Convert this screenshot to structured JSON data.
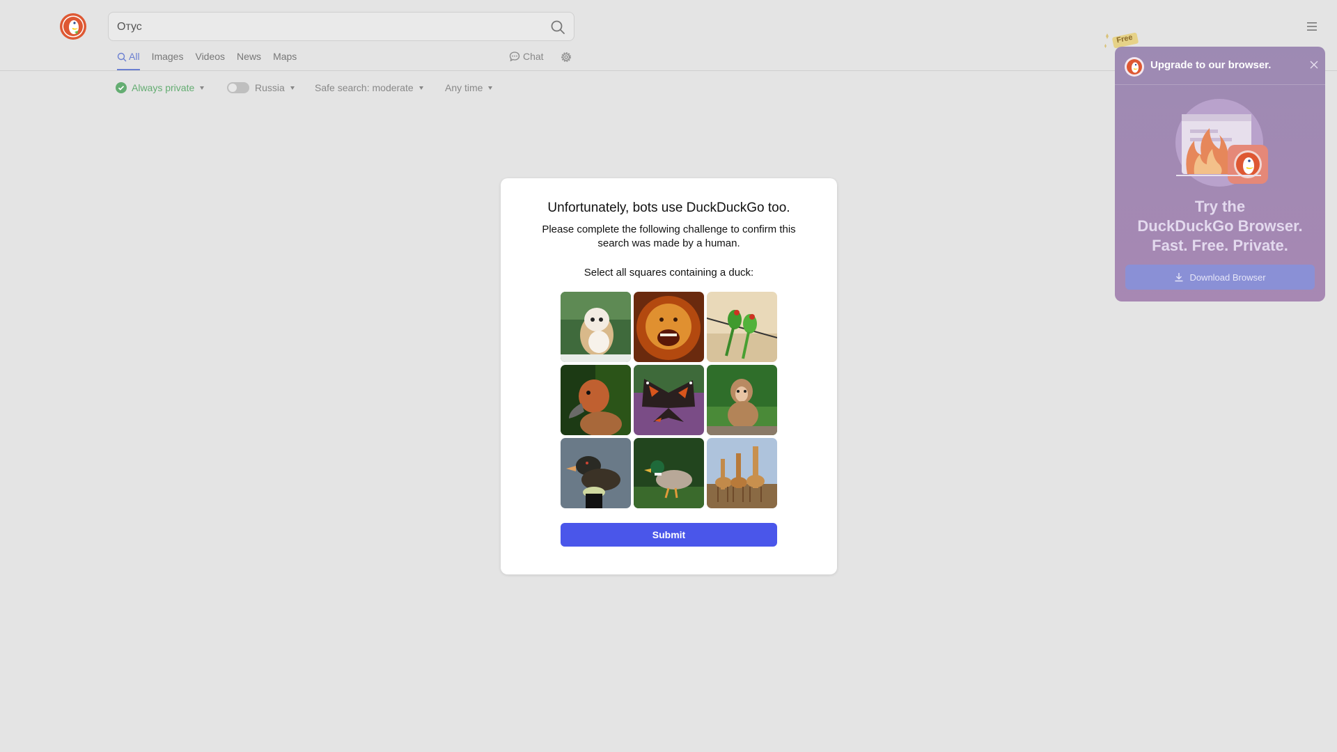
{
  "search": {
    "value": "Отус"
  },
  "nav": {
    "tabs": [
      {
        "label": "All"
      },
      {
        "label": "Images"
      },
      {
        "label": "Videos"
      },
      {
        "label": "News"
      },
      {
        "label": "Maps"
      }
    ],
    "chat_label": "Chat"
  },
  "filters": {
    "privacy": "Always private",
    "region": "Russia",
    "safe_search": "Safe search: moderate",
    "time": "Any time"
  },
  "captcha": {
    "title": "Unfortunately, bots use DuckDuckGo too.",
    "subtitle": "Please complete the following challenge to confirm this search was made by a human.",
    "instruction": "Select all squares containing a duck:",
    "tiles": [
      "owl",
      "lion",
      "parrots",
      "duck",
      "butterfly",
      "monkey",
      "duck",
      "mallard duck",
      "giraffes"
    ],
    "submit_label": "Submit"
  },
  "promo": {
    "title": "Upgrade to our browser.",
    "badge": "Free",
    "headline_1": "Try the",
    "headline_2": "DuckDuckGo Browser.",
    "headline_3": "Fast. Free. Private.",
    "button_label": "Download Browser"
  },
  "colors": {
    "accent": "#4a56ea",
    "nav_active": "#6a7fd1",
    "privacy_green": "#64ad72",
    "promo_bg": "#a388b5"
  },
  "icons": [
    "duckduckgo-logo",
    "search-icon",
    "chat-icon",
    "gear-icon",
    "hamburger-menu-icon",
    "check-icon",
    "close-icon",
    "download-icon"
  ]
}
